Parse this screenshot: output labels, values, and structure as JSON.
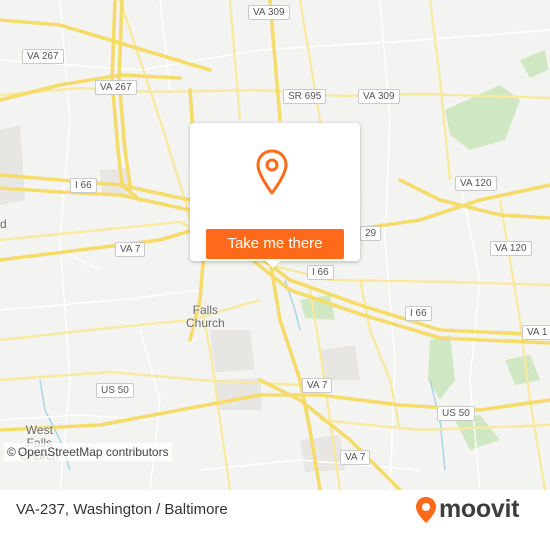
{
  "map": {
    "road_shields": [
      {
        "id": "va267-top",
        "label": "VA 267"
      },
      {
        "id": "va309-top",
        "label": "VA 309"
      },
      {
        "id": "va267-mid",
        "label": "VA 267"
      },
      {
        "id": "sr695",
        "label": "SR 695"
      },
      {
        "id": "va309-mid",
        "label": "VA 309"
      },
      {
        "id": "i66-left",
        "label": "I 66"
      },
      {
        "id": "va120-top",
        "label": "VA 120"
      },
      {
        "id": "va7-left",
        "label": "VA 7"
      },
      {
        "id": "va29",
        "label": "29"
      },
      {
        "id": "va120-right",
        "label": "VA 120"
      },
      {
        "id": "i66-center",
        "label": "I 66"
      },
      {
        "id": "i66-right",
        "label": "I 66"
      },
      {
        "id": "va1-right",
        "label": "VA 1"
      },
      {
        "id": "us50-left",
        "label": "US 50"
      },
      {
        "id": "va7-center",
        "label": "VA 7"
      },
      {
        "id": "us50-right",
        "label": "US 50"
      },
      {
        "id": "va7-bottom",
        "label": "VA 7"
      }
    ],
    "places": [
      {
        "id": "falls-church",
        "label": "Falls\nChurch"
      },
      {
        "id": "west-falls-church",
        "label": "West\nFalls\nChurch"
      },
      {
        "id": "edge-left",
        "label": "d"
      }
    ],
    "attribution": {
      "symbol": "©",
      "text": "OpenStreetMap contributors"
    },
    "colors": {
      "land": "#f3f3f1",
      "highway": "#f5dc6a",
      "road": "#f8e9a1",
      "park": "#cfe8c3",
      "water": "#a8d4ea"
    }
  },
  "popup": {
    "pin_icon": "map-pin-icon",
    "button_label": "Take me there",
    "accent": "#ff6a1a"
  },
  "footer": {
    "title": "VA-237, Washington / Baltimore",
    "brand": "moovit",
    "brand_color": "#ff6a1a"
  }
}
